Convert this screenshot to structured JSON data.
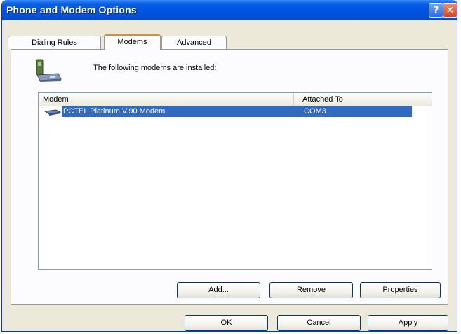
{
  "window": {
    "title": "Phone and Modem Options",
    "help_glyph": "?",
    "close_glyph": "✕"
  },
  "tabs": [
    {
      "label": "Dialing Rules",
      "active": false
    },
    {
      "label": "Modems",
      "active": true
    },
    {
      "label": "Advanced",
      "active": false
    }
  ],
  "modems_panel": {
    "header_text": "The following modems are installed:",
    "header_icon": "phone-modem-icon",
    "columns": [
      "Modem",
      "Attached To"
    ],
    "rows": [
      {
        "modem": "PCTEL Platinum V.90 Modem",
        "attached_to": "COM3",
        "selected": true,
        "icon": "modem-icon"
      }
    ],
    "buttons": {
      "add": "Add...",
      "remove": "Remove",
      "properties": "Properties"
    }
  },
  "dialog_buttons": {
    "ok": "OK",
    "cancel": "Cancel",
    "apply": "Apply"
  },
  "colors": {
    "titlebar": "#0054e3",
    "selection": "#316ac5",
    "tab_active_accent": "#e68b2c",
    "dialog_face": "#ece9d8"
  }
}
